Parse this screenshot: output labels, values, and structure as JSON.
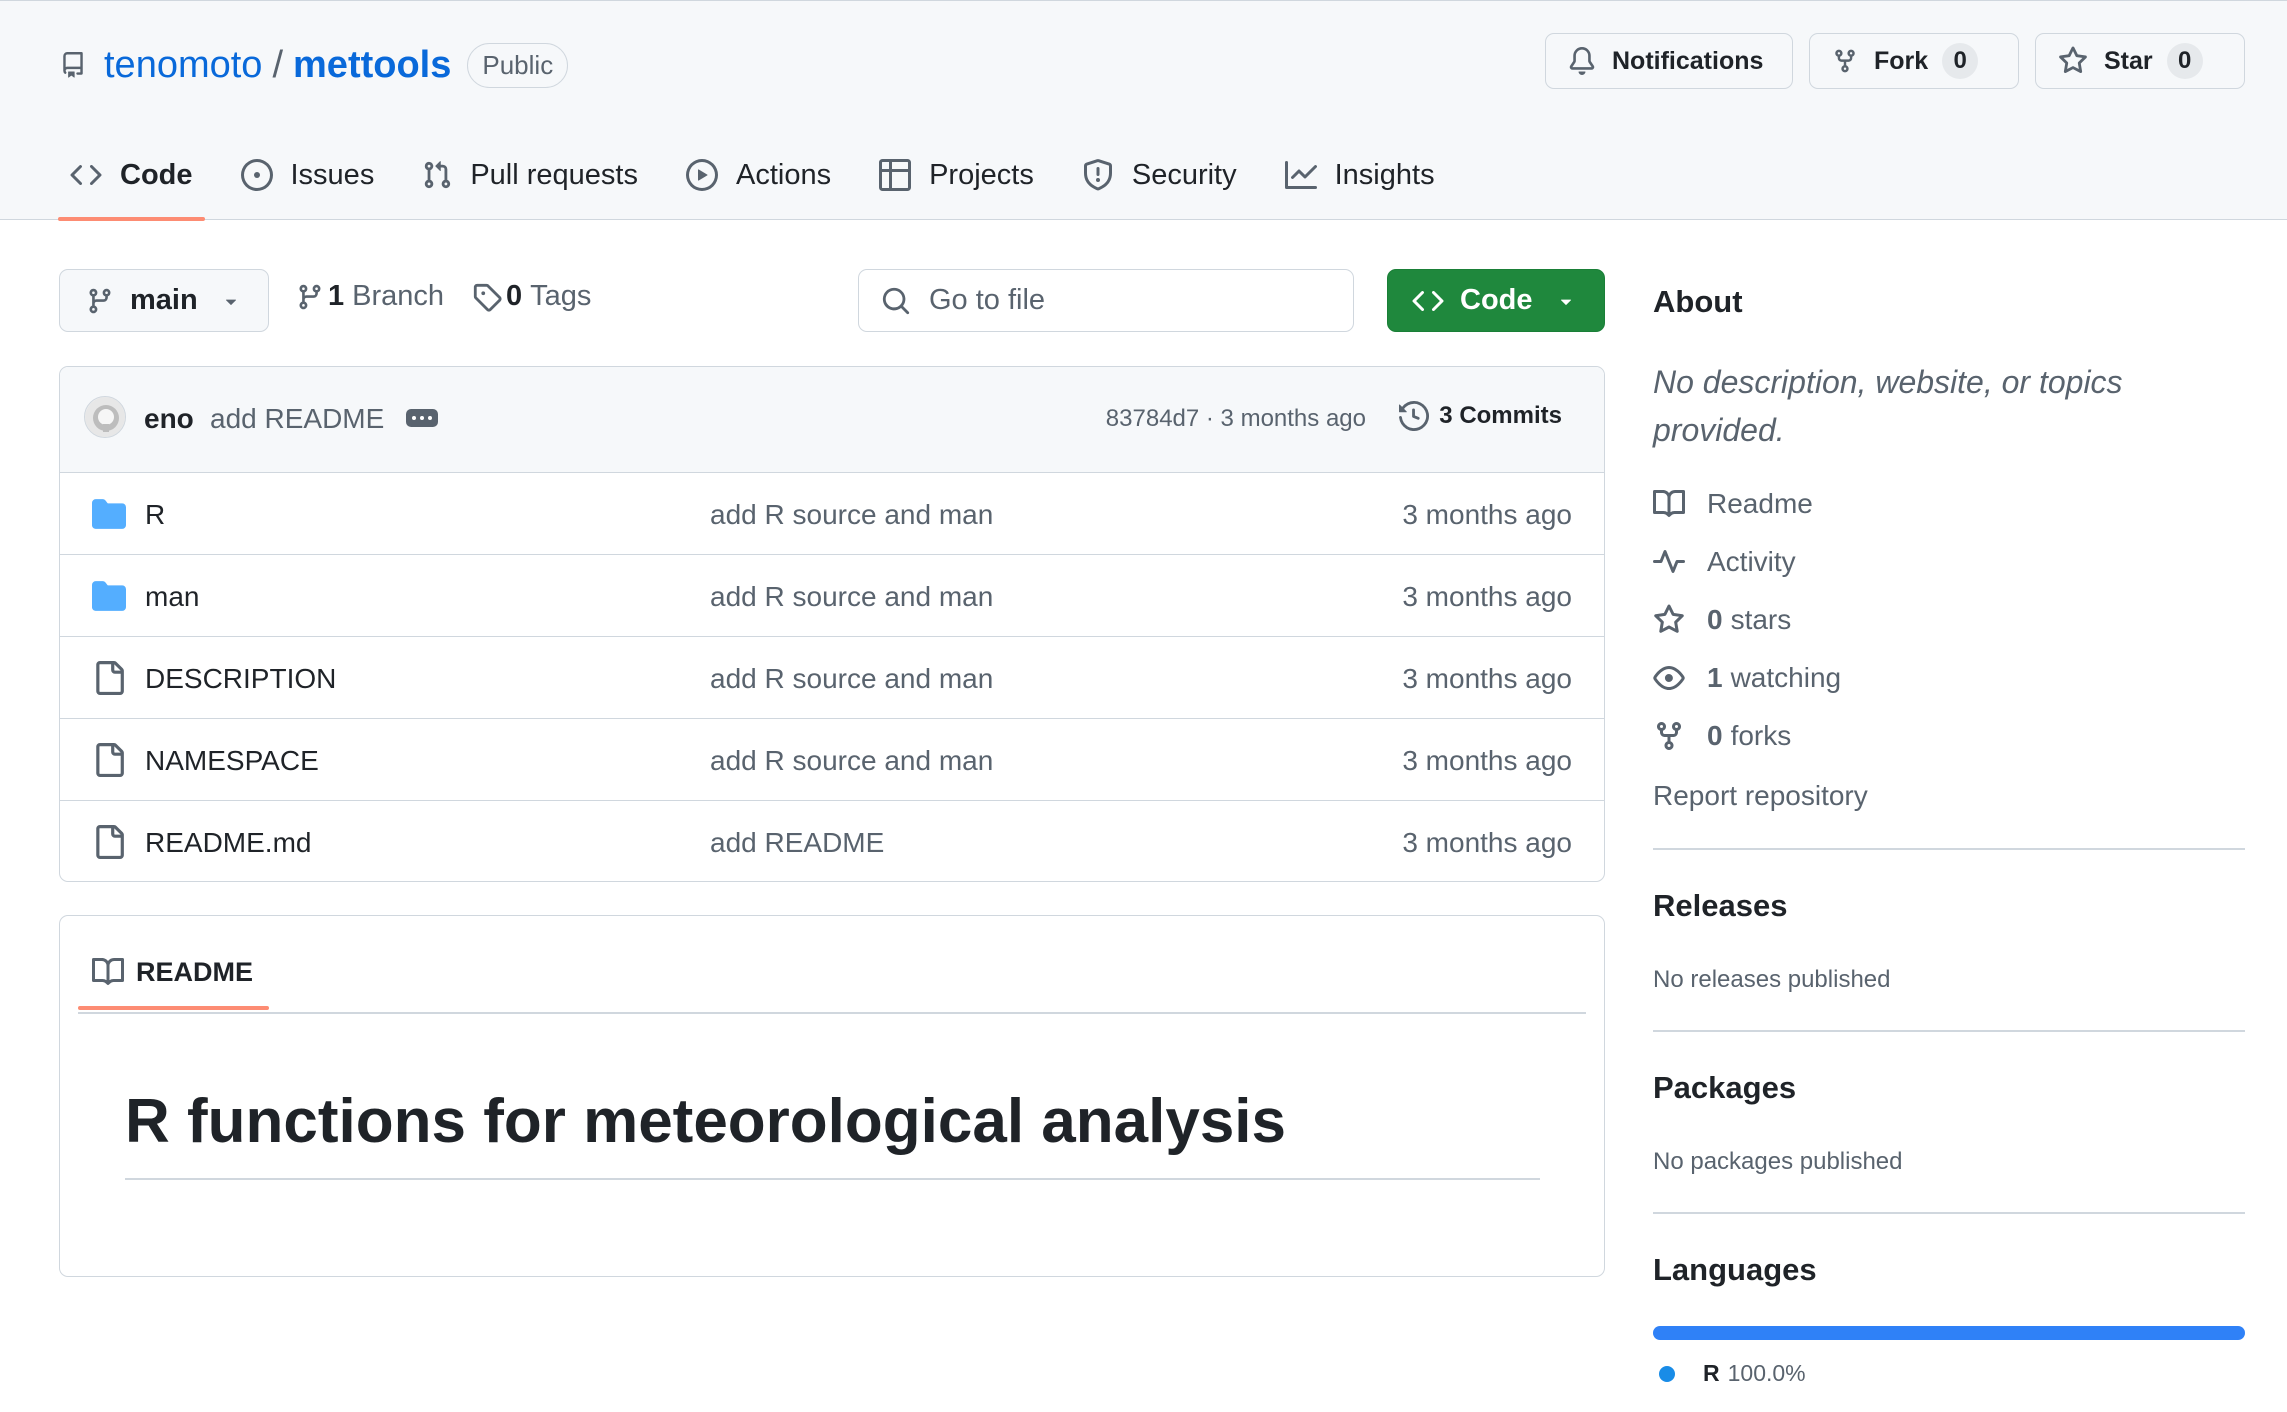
{
  "repo": {
    "owner": "tenomoto",
    "separator": "/",
    "name": "mettools",
    "visibility": "Public"
  },
  "header_buttons": {
    "notifications": "Notifications",
    "fork": {
      "label": "Fork",
      "count": "0"
    },
    "star": {
      "label": "Star",
      "count": "0"
    }
  },
  "tabs": [
    {
      "label": "Code",
      "icon": "code-icon"
    },
    {
      "label": "Issues",
      "icon": "issue-opened-icon"
    },
    {
      "label": "Pull requests",
      "icon": "git-pull-request-icon"
    },
    {
      "label": "Actions",
      "icon": "play-icon"
    },
    {
      "label": "Projects",
      "icon": "table-icon"
    },
    {
      "label": "Security",
      "icon": "shield-icon"
    },
    {
      "label": "Insights",
      "icon": "graph-icon"
    }
  ],
  "file_nav": {
    "branch": "main",
    "branches_count": "1",
    "branches_label": "Branch",
    "tags_count": "0",
    "tags_label": "Tags",
    "goto_placeholder": "Go to file",
    "code_button": "Code"
  },
  "latest_commit": {
    "author": "eno",
    "message": "add README",
    "hash_time": "83784d7 · 3 months ago",
    "commits_count": "3",
    "commits_label": "Commits"
  },
  "files": [
    {
      "type": "dir",
      "name": "R",
      "message": "add R source and man",
      "time": "3 months ago"
    },
    {
      "type": "dir",
      "name": "man",
      "message": "add R source and man",
      "time": "3 months ago"
    },
    {
      "type": "file",
      "name": "DESCRIPTION",
      "message": "add R source and man",
      "time": "3 months ago"
    },
    {
      "type": "file",
      "name": "NAMESPACE",
      "message": "add R source and man",
      "time": "3 months ago"
    },
    {
      "type": "file",
      "name": "README.md",
      "message": "add README",
      "time": "3 months ago"
    }
  ],
  "readme": {
    "tab_label": "README",
    "heading": "R functions for meteorological analysis"
  },
  "about": {
    "title": "About",
    "description": "No description, website, or topics provided.",
    "readme": "Readme",
    "activity": "Activity",
    "stars_count": "0",
    "stars_label": "stars",
    "watching_count": "1",
    "watching_label": "watching",
    "forks_count": "0",
    "forks_label": "forks",
    "report": "Report repository"
  },
  "releases": {
    "title": "Releases",
    "text": "No releases published"
  },
  "packages": {
    "title": "Packages",
    "text": "No packages published"
  },
  "languages": {
    "title": "Languages",
    "items": [
      {
        "name": "R",
        "percent": "100.0%",
        "fraction": 1.0,
        "color": "#198CE7"
      }
    ]
  },
  "colors": {
    "accent": "#0969da",
    "green": "#1f883d",
    "tab_underline": "#fd8c73",
    "folder": "#54aeff"
  }
}
